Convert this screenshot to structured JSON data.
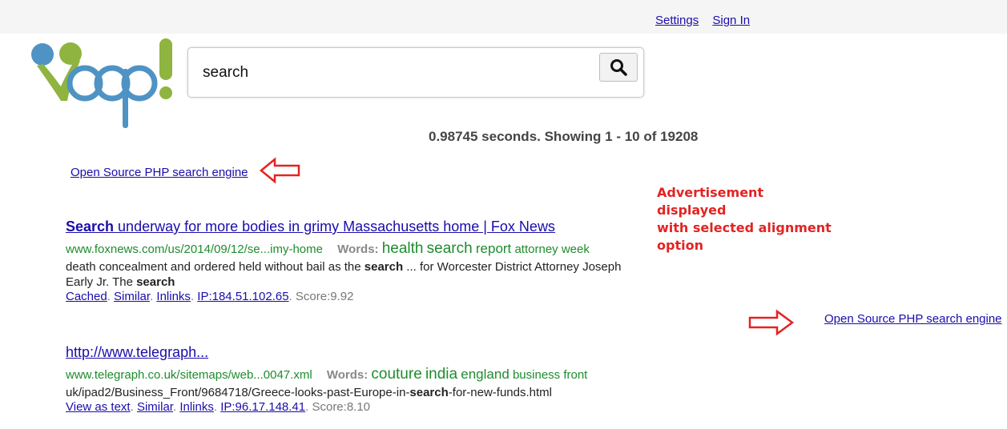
{
  "header": {
    "links": [
      "Settings",
      "Sign In"
    ]
  },
  "search": {
    "query": "search"
  },
  "stats": "0.98745 seconds. Showing 1 - 10 of 19208",
  "ads": {
    "top_link": "Open Source PHP search engine",
    "right_link": "Open Source PHP search engine"
  },
  "annotation": {
    "lines": [
      "Advertisement displayed",
      "with selected alignment",
      "option"
    ],
    "color": "#e32322"
  },
  "results": [
    {
      "title_strong": "Search",
      "title_rest": " underway for more bodies in grimy Massachusetts home | Fox News",
      "url": "www.foxnews.com/us/2014/09/12/se...imy-home",
      "words_label": "Words:",
      "words_big": [
        "health",
        "search",
        "report"
      ],
      "words_small": [
        "attorney",
        "week"
      ],
      "snippet_1": "death concealment and ordered held without bail as the ",
      "snippet_b1": "search",
      "snippet_2": " ... for Worcester District Attorney Joseph",
      "snippet_3": "Early Jr. The ",
      "snippet_b2": "search",
      "links": [
        "Cached",
        "Similar",
        "Inlinks",
        "IP:184.51.102.65"
      ],
      "score": "Score:9.92"
    },
    {
      "title": "http://www.telegraph...",
      "url": "www.telegraph.co.uk/sitemaps/web...0047.xml",
      "words_label": "Words:",
      "words_big": [
        "couture",
        "india",
        "england"
      ],
      "words_small": [
        "business",
        "front"
      ],
      "snippet_1": "uk/ipad2/Business_Front/9684718/Greece-looks-past-Europe-in-",
      "snippet_b1": "search",
      "snippet_2": "-for-new-funds.html",
      "links": [
        "View as text",
        "Similar",
        "Inlinks",
        "IP:96.17.148.41"
      ],
      "score": "Score:8.10"
    }
  ],
  "colors": {
    "link": "#1a0dab",
    "url_green": "#1e8c2e",
    "logo_blue": "#4f93c4",
    "logo_green": "#8fb440"
  },
  "icons": {
    "search_button": "magnifier-icon",
    "arrows": "outline-arrow-icon"
  }
}
